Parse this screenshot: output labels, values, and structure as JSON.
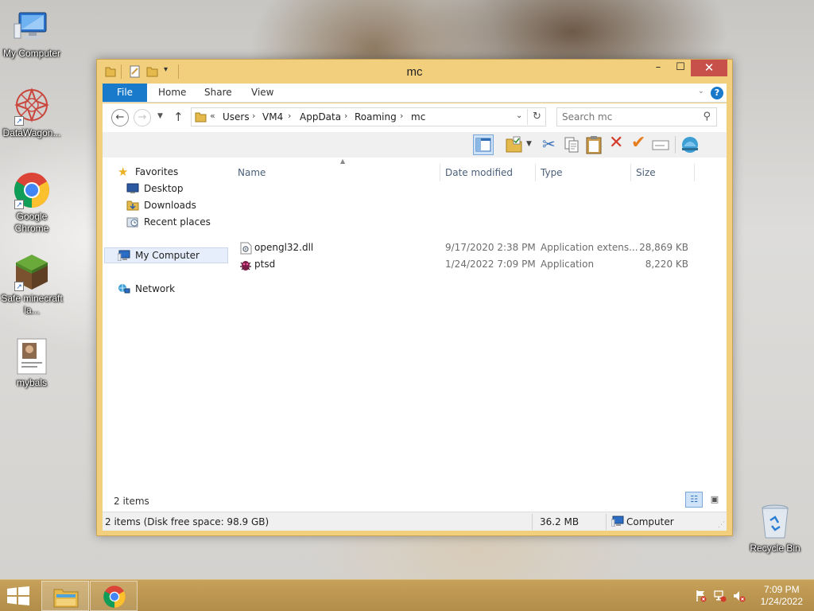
{
  "desktop": {
    "icons": [
      {
        "label": "My Computer"
      },
      {
        "label": "DataWagon..."
      },
      {
        "label": "Google Chrome"
      },
      {
        "label": "Safe minecraft la..."
      },
      {
        "label": "mybals"
      },
      {
        "label": "Recycle Bin"
      }
    ],
    "mybals_thumb_text": "Wiew (Lucida) mybals"
  },
  "window": {
    "title": "mc",
    "controls": {
      "minimize": "–",
      "maximize": "☐",
      "close": "✕"
    }
  },
  "ribbon": {
    "tabs": [
      "File",
      "Home",
      "Share",
      "View"
    ],
    "help": "?"
  },
  "address": {
    "overflow": "«",
    "crumbs": [
      "Users",
      "VM4",
      "AppData",
      "Roaming",
      "mc"
    ],
    "search_placeholder": "Search mc"
  },
  "nav_pane": {
    "favorites": "Favorites",
    "favorites_items": [
      "Desktop",
      "Downloads",
      "Recent places"
    ],
    "my_computer": "My Computer",
    "network": "Network"
  },
  "file_list": {
    "columns": [
      "Name",
      "Date modified",
      "Type",
      "Size"
    ],
    "rows": [
      {
        "name": "opengl32.dll",
        "date": "9/17/2020 2:38 PM",
        "type": "Application extens...",
        "size": "28,869 KB",
        "icon": "dll-file-icon"
      },
      {
        "name": "ptsd",
        "date": "1/24/2022 7:09 PM",
        "type": "Application",
        "size": "8,220 KB",
        "icon": "app-bug-icon"
      }
    ],
    "item_count": "2 items"
  },
  "status_bar": {
    "summary": "2 items (Disk free space: 98.9 GB)",
    "size": "36.2 MB",
    "location": "Computer"
  },
  "taskbar": {
    "clock_time": "7:09 PM",
    "clock_date": "1/24/2022"
  },
  "colors": {
    "window_frame": "#f2cf7d",
    "file_tab": "#1979ca",
    "close_button": "#c7504b",
    "taskbar": "#b18d4a"
  }
}
